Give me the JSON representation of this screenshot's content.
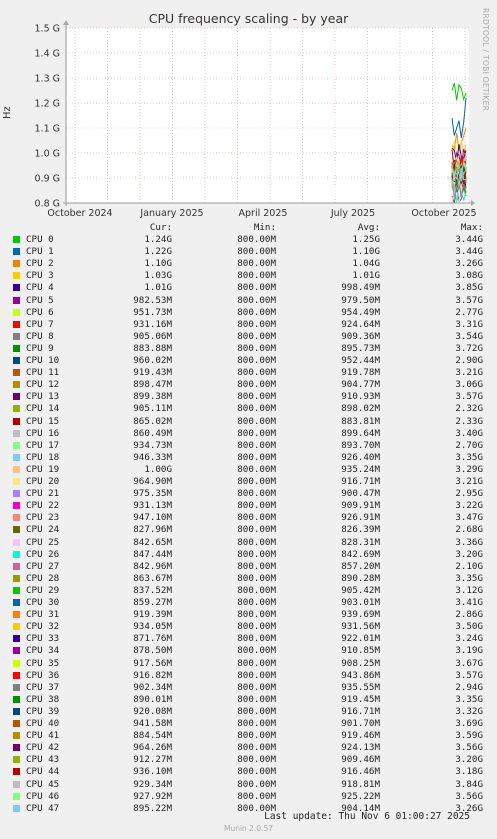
{
  "chart_data": {
    "type": "line",
    "title": "CPU frequency scaling - by year",
    "ylabel": "Hz",
    "ylim": [
      0.8,
      1.5
    ],
    "ytick_values": [
      0.8,
      0.9,
      1.0,
      1.1,
      1.2,
      1.3,
      1.4,
      1.5
    ],
    "ytick_labels": [
      "0.8 G",
      "0.9 G",
      "1.0 G",
      "1.1 G",
      "1.2 G",
      "1.3 G",
      "1.4 G",
      "1.5 G"
    ],
    "xtick_labels": [
      "October 2024",
      "January 2025",
      "April 2025",
      "July 2025",
      "October 2025"
    ],
    "grid": true,
    "column_headers": [
      "Cur:",
      "Min:",
      "Avg:",
      "Max:"
    ],
    "series": [
      {
        "name": "CPU 0",
        "color": "#00cc00",
        "cur": "1.24G",
        "min": "800.00M",
        "avg": "1.25G",
        "max": "3.44G"
      },
      {
        "name": "CPU 1",
        "color": "#0066b3",
        "cur": "1.22G",
        "min": "800.00M",
        "avg": "1.10G",
        "max": "3.44G"
      },
      {
        "name": "CPU 2",
        "color": "#ff8000",
        "cur": "1.10G",
        "min": "800.00M",
        "avg": "1.04G",
        "max": "3.26G"
      },
      {
        "name": "CPU 3",
        "color": "#ffcc00",
        "cur": "1.03G",
        "min": "800.00M",
        "avg": "1.01G",
        "max": "3.08G"
      },
      {
        "name": "CPU 4",
        "color": "#330099",
        "cur": "1.01G",
        "min": "800.00M",
        "avg": "998.49M",
        "max": "3.85G"
      },
      {
        "name": "CPU 5",
        "color": "#990099",
        "cur": "982.53M",
        "min": "800.00M",
        "avg": "979.50M",
        "max": "3.57G"
      },
      {
        "name": "CPU 6",
        "color": "#ccff00",
        "cur": "951.73M",
        "min": "800.00M",
        "avg": "954.49M",
        "max": "2.77G"
      },
      {
        "name": "CPU 7",
        "color": "#ff0000",
        "cur": "931.16M",
        "min": "800.00M",
        "avg": "924.64M",
        "max": "3.31G"
      },
      {
        "name": "CPU 8",
        "color": "#808080",
        "cur": "905.06M",
        "min": "800.00M",
        "avg": "909.36M",
        "max": "3.54G"
      },
      {
        "name": "CPU 9",
        "color": "#008f00",
        "cur": "883.88M",
        "min": "800.00M",
        "avg": "895.73M",
        "max": "3.72G"
      },
      {
        "name": "CPU 10",
        "color": "#00487d",
        "cur": "960.02M",
        "min": "800.00M",
        "avg": "952.44M",
        "max": "2.90G"
      },
      {
        "name": "CPU 11",
        "color": "#b35a00",
        "cur": "919.43M",
        "min": "800.00M",
        "avg": "919.78M",
        "max": "3.21G"
      },
      {
        "name": "CPU 12",
        "color": "#b38f00",
        "cur": "898.47M",
        "min": "800.00M",
        "avg": "904.77M",
        "max": "3.06G"
      },
      {
        "name": "CPU 13",
        "color": "#6b006b",
        "cur": "899.38M",
        "min": "800.00M",
        "avg": "910.93M",
        "max": "3.57G"
      },
      {
        "name": "CPU 14",
        "color": "#8fb300",
        "cur": "905.11M",
        "min": "800.00M",
        "avg": "898.02M",
        "max": "2.32G"
      },
      {
        "name": "CPU 15",
        "color": "#b30000",
        "cur": "865.02M",
        "min": "800.00M",
        "avg": "883.81M",
        "max": "2.33G"
      },
      {
        "name": "CPU 16",
        "color": "#bebebe",
        "cur": "860.49M",
        "min": "800.00M",
        "avg": "899.64M",
        "max": "3.40G"
      },
      {
        "name": "CPU 17",
        "color": "#80ff80",
        "cur": "934.73M",
        "min": "800.00M",
        "avg": "893.70M",
        "max": "2.70G"
      },
      {
        "name": "CPU 18",
        "color": "#80c9ff",
        "cur": "946.33M",
        "min": "800.00M",
        "avg": "926.40M",
        "max": "3.35G"
      },
      {
        "name": "CPU 19",
        "color": "#ffc080",
        "cur": "1.00G",
        "min": "800.00M",
        "avg": "935.24M",
        "max": "3.29G"
      },
      {
        "name": "CPU 20",
        "color": "#ffe680",
        "cur": "964.90M",
        "min": "800.00M",
        "avg": "916.71M",
        "max": "3.21G"
      },
      {
        "name": "CPU 21",
        "color": "#aa80ff",
        "cur": "975.35M",
        "min": "800.00M",
        "avg": "900.47M",
        "max": "2.95G"
      },
      {
        "name": "CPU 22",
        "color": "#ee00cc",
        "cur": "931.13M",
        "min": "800.00M",
        "avg": "909.91M",
        "max": "3.22G"
      },
      {
        "name": "CPU 23",
        "color": "#ff8080",
        "cur": "947.10M",
        "min": "800.00M",
        "avg": "926.91M",
        "max": "3.47G"
      },
      {
        "name": "CPU 24",
        "color": "#666600",
        "cur": "827.96M",
        "min": "800.00M",
        "avg": "826.39M",
        "max": "2.68G"
      },
      {
        "name": "CPU 25",
        "color": "#ffbfff",
        "cur": "842.65M",
        "min": "800.00M",
        "avg": "828.31M",
        "max": "3.36G"
      },
      {
        "name": "CPU 26",
        "color": "#00ffcc",
        "cur": "847.44M",
        "min": "800.00M",
        "avg": "842.69M",
        "max": "3.20G"
      },
      {
        "name": "CPU 27",
        "color": "#cc6699",
        "cur": "842.96M",
        "min": "800.00M",
        "avg": "857.20M",
        "max": "2.10G"
      },
      {
        "name": "CPU 28",
        "color": "#999900",
        "cur": "863.67M",
        "min": "800.00M",
        "avg": "890.28M",
        "max": "3.35G"
      },
      {
        "name": "CPU 29",
        "color": "#00cc00",
        "cur": "837.52M",
        "min": "800.00M",
        "avg": "905.42M",
        "max": "3.12G"
      },
      {
        "name": "CPU 30",
        "color": "#0066b3",
        "cur": "859.27M",
        "min": "800.00M",
        "avg": "903.01M",
        "max": "3.41G"
      },
      {
        "name": "CPU 31",
        "color": "#ff8000",
        "cur": "919.39M",
        "min": "800.00M",
        "avg": "939.69M",
        "max": "2.86G"
      },
      {
        "name": "CPU 32",
        "color": "#ffcc00",
        "cur": "934.05M",
        "min": "800.00M",
        "avg": "931.56M",
        "max": "3.50G"
      },
      {
        "name": "CPU 33",
        "color": "#330099",
        "cur": "871.76M",
        "min": "800.00M",
        "avg": "922.01M",
        "max": "3.24G"
      },
      {
        "name": "CPU 34",
        "color": "#990099",
        "cur": "878.50M",
        "min": "800.00M",
        "avg": "910.85M",
        "max": "3.19G"
      },
      {
        "name": "CPU 35",
        "color": "#ccff00",
        "cur": "917.56M",
        "min": "800.00M",
        "avg": "908.25M",
        "max": "3.67G"
      },
      {
        "name": "CPU 36",
        "color": "#ff0000",
        "cur": "916.82M",
        "min": "800.00M",
        "avg": "943.86M",
        "max": "3.57G"
      },
      {
        "name": "CPU 37",
        "color": "#808080",
        "cur": "902.34M",
        "min": "800.00M",
        "avg": "935.55M",
        "max": "2.94G"
      },
      {
        "name": "CPU 38",
        "color": "#008f00",
        "cur": "890.01M",
        "min": "800.00M",
        "avg": "919.45M",
        "max": "3.35G"
      },
      {
        "name": "CPU 39",
        "color": "#00487d",
        "cur": "920.08M",
        "min": "800.00M",
        "avg": "916.71M",
        "max": "3.32G"
      },
      {
        "name": "CPU 40",
        "color": "#b35a00",
        "cur": "941.58M",
        "min": "800.00M",
        "avg": "901.70M",
        "max": "3.69G"
      },
      {
        "name": "CPU 41",
        "color": "#b38f00",
        "cur": "884.54M",
        "min": "800.00M",
        "avg": "919.46M",
        "max": "3.59G"
      },
      {
        "name": "CPU 42",
        "color": "#6b006b",
        "cur": "964.26M",
        "min": "800.00M",
        "avg": "924.13M",
        "max": "3.56G"
      },
      {
        "name": "CPU 43",
        "color": "#8fb300",
        "cur": "912.27M",
        "min": "800.00M",
        "avg": "909.46M",
        "max": "3.20G"
      },
      {
        "name": "CPU 44",
        "color": "#b30000",
        "cur": "936.10M",
        "min": "800.00M",
        "avg": "916.46M",
        "max": "3.18G"
      },
      {
        "name": "CPU 45",
        "color": "#bebebe",
        "cur": "929.34M",
        "min": "800.00M",
        "avg": "918.81M",
        "max": "3.84G"
      },
      {
        "name": "CPU 46",
        "color": "#80ff80",
        "cur": "927.92M",
        "min": "800.00M",
        "avg": "925.22M",
        "max": "3.56G"
      },
      {
        "name": "CPU 47",
        "color": "#80c9ff",
        "cur": "895.22M",
        "min": "800.00M",
        "avg": "904.14M",
        "max": "3.26G"
      }
    ]
  },
  "side_label": "RRDTOOL / TOBI OETIKER",
  "last_update": "Last update: Thu Nov  6 01:00:27 2025",
  "footer": "Munin 2.0.57"
}
